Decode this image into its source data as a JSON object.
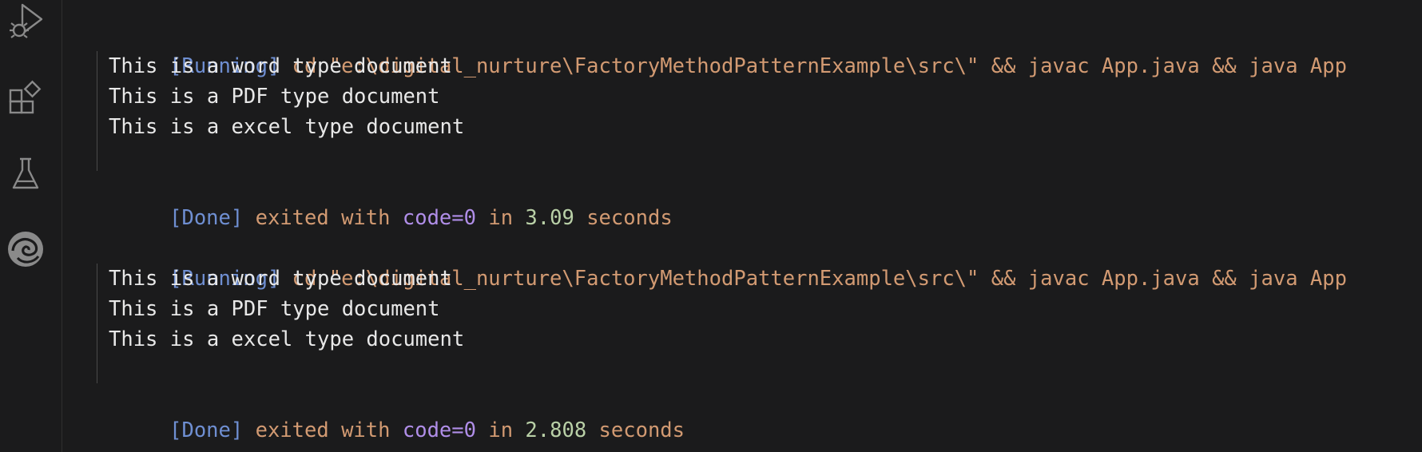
{
  "activity_bar": {
    "icons": [
      "run-debug-icon",
      "extensions-icon",
      "testing-icon",
      "edge-browser-icon"
    ]
  },
  "runs": [
    {
      "running_tag": "[Running]",
      "command": "cd \"e:\\digital_nurture\\FactoryMethodPatternExample\\src\\\" && javac App.java && java App",
      "outputs": [
        "This is a word type document",
        "This is a PDF type document",
        "This is a excel type document"
      ],
      "done_tag": "[Done]",
      "exited_with": "exited with",
      "code": "code=0",
      "in": "in",
      "duration": "3.09",
      "seconds": "seconds"
    },
    {
      "running_tag": "[Running]",
      "command": "cd \"e:\\digital_nurture\\FactoryMethodPatternExample\\src\\\" && javac App.java && java App",
      "outputs": [
        "This is a word type document",
        "This is a PDF type document",
        "This is a excel type document"
      ],
      "done_tag": "[Done]",
      "exited_with": "exited with",
      "code": "code=0",
      "in": "in",
      "duration": "2.808",
      "seconds": "seconds"
    }
  ]
}
